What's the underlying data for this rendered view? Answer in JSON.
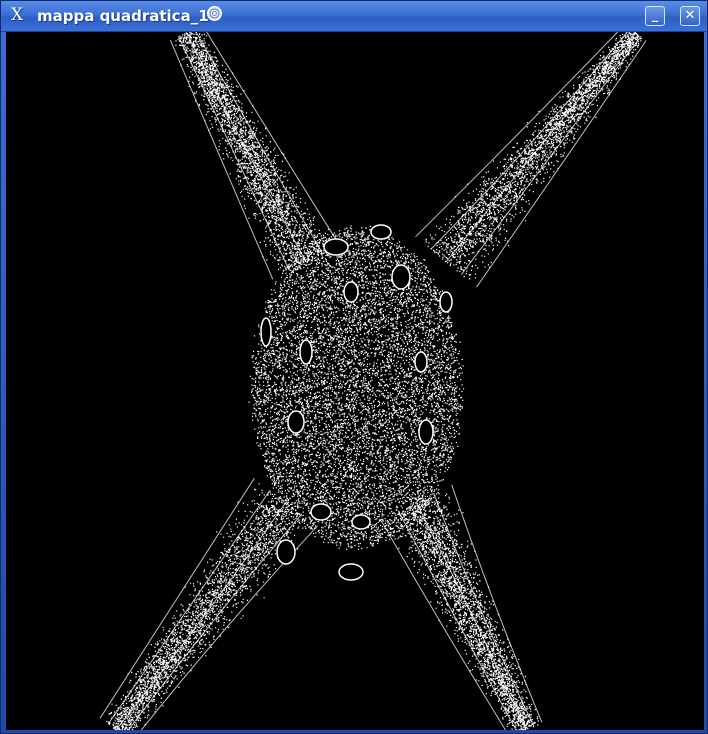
{
  "window": {
    "title": "mappa quadratica_1",
    "app_icon": "x-window-icon",
    "app_icon_glyph": "X",
    "busy_icon": "spinner-icon",
    "minimize_label": "_",
    "close_label": "✕"
  },
  "canvas": {
    "background_color": "#000000",
    "point_color": "#ffffff",
    "content": "quadratic-map-attractor-plot"
  },
  "colors": {
    "titlebar": "#3a6fd4",
    "frame": "#2b4fa8"
  }
}
